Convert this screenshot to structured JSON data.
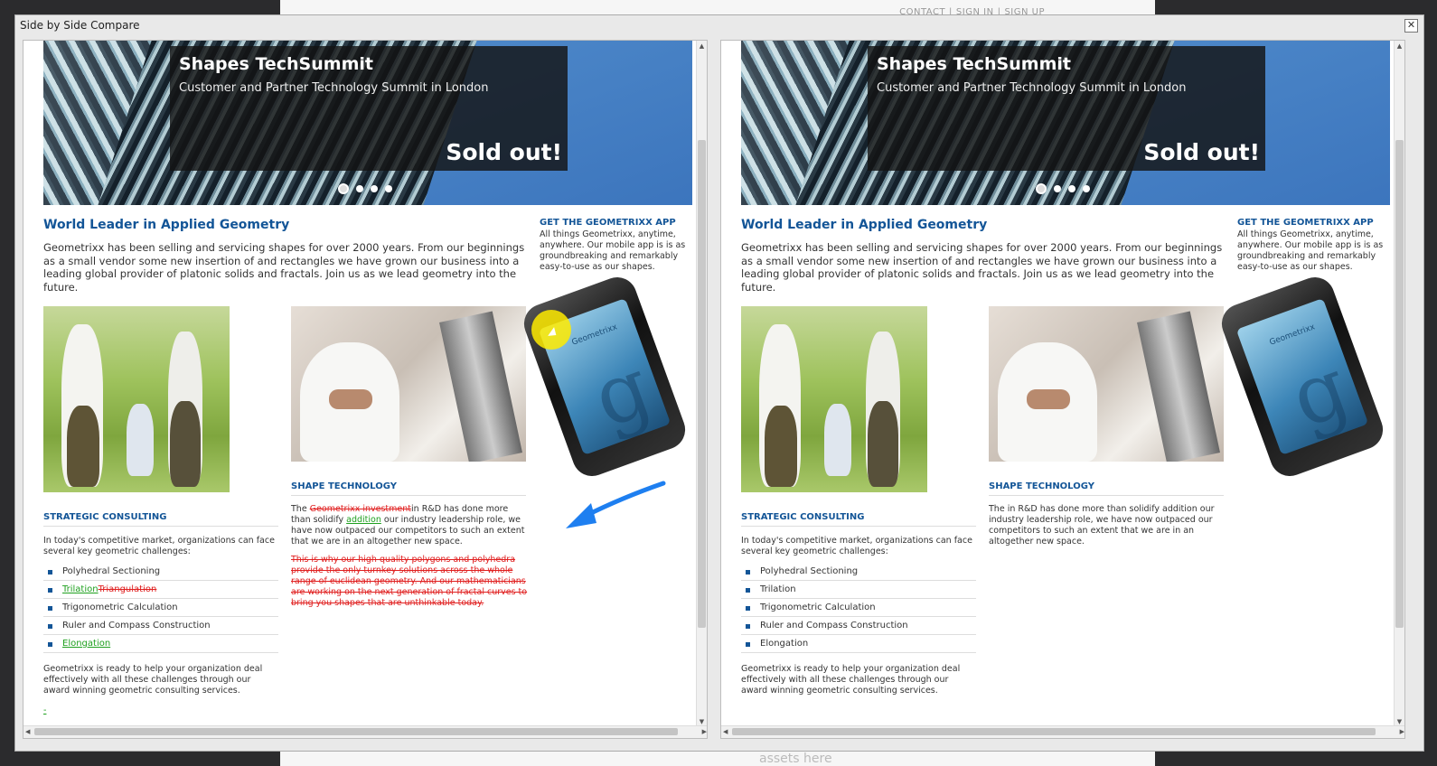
{
  "background_page": {
    "nav": [
      "CONTACT",
      "SIGN IN",
      "SIGN UP"
    ],
    "footer_text": "assets here"
  },
  "dialog": {
    "title": "Side by Side Compare",
    "close_glyph": "✕"
  },
  "panes": {
    "banner": {
      "title": "Shapes TechSummit",
      "subtitle": "Customer and Partner Technology Summit in London",
      "badge": "Sold out!"
    },
    "heading": "World Leader in Applied Geometry",
    "intro": "Geometrixx has been selling and servicing shapes for over 2000 years. From our beginnings as a small vendor some new insertion of and rectangles we have grown our business into a leading global provider of platonic solids and fractals. Join us as we lead geometry into the future.",
    "app": {
      "title": "GET THE GEOMETRIXX APP",
      "text": "All things Geometrixx, anytime, anywhere. Our mobile app is is as groundbreaking and remarkably easy-to-use as our shapes.",
      "phone_brand": "Geometrixx",
      "phone_logo": "g"
    },
    "strategic": {
      "title": "STRATEGIC CONSULTING",
      "intro": "In today's competitive market, organizations can face several key geometric challenges:",
      "outro": "Geometrixx is ready to help your organization deal effectively with all these challenges through our award winning geometric consulting services.",
      "trailing_mark": "-"
    },
    "shape_tech_title": "SHAPE TECHNOLOGY"
  },
  "left_pane": {
    "list": {
      "item1": "Polyhedral Sectioning",
      "item2_ins": "Trilation",
      "item2_del": "Triangulation",
      "item3": "Trigonometric Calculation",
      "item4": "Ruler and Compass Construction",
      "item5_ins": "Elongation"
    },
    "shape_tech": {
      "p1_a": "The ",
      "p1_del": "Geometrixx investment",
      "p1_b": "in R&D has done more than solidify ",
      "p1_ins": "addition",
      "p1_c": " our industry leadership role, we have now outpaced our competitors to such an extent that we are in an altogether new space.",
      "p2_del": "This is why our high quality polygons and polyhedra provide the only turnkey solutions across the whole range of euclidean geometry. And our mathematicians are working on the next generation of fractal curves to bring you shapes that are unthinkable today."
    }
  },
  "right_pane": {
    "list": [
      "Polyhedral Sectioning",
      "Trilation",
      "Trigonometric Calculation",
      "Ruler and Compass Construction",
      "Elongation"
    ],
    "shape_tech_text": "The in R&D has done more than solidify addition our industry leadership role, we have now outpaced our competitors to such an extent that we are in an altogether new space."
  },
  "colors": {
    "heading_blue": "#135597",
    "inserted_green": "#1fa01f",
    "deleted_red": "#e02020",
    "annotation_arrow": "#1e7ff0",
    "cursor_highlight": "#ffeb00"
  }
}
